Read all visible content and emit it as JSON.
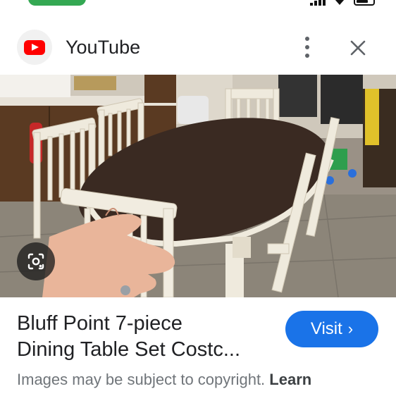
{
  "source": {
    "name": "YouTube",
    "icon": "youtube-logo-icon"
  },
  "header_actions": {
    "more_icon": "more-vert-icon",
    "close_icon": "close-icon"
  },
  "image": {
    "description_icon": "lens-icon"
  },
  "result": {
    "title_line1": "Bluff Point 7-piece",
    "title_line2": "Dining Table Set Costc...",
    "visit_label": "Visit",
    "visit_chevron": "›"
  },
  "footer": {
    "copyright_text": "Images may be subject to copyright.",
    "learn_label": "Learn"
  },
  "colors": {
    "accent": "#1a73e8",
    "youtube_red": "#ff0000",
    "status_green": "#34a853"
  }
}
